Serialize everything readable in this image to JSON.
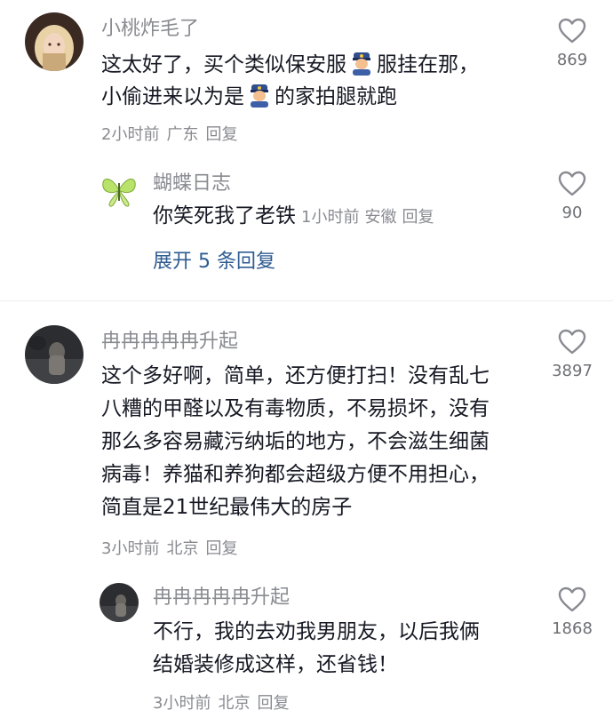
{
  "comments": [
    {
      "username": "小桃炸毛了",
      "line1_a": "这太好了，买个类似保安服",
      "line1_b": "服挂在那，",
      "line2_a": "小偷进来以为是",
      "line2_b": "的家拍腿就跑",
      "emoji": "police-officer-emoji",
      "time": "2小时前",
      "location": "广东",
      "reply_label": "回复",
      "like_count": "869",
      "reply": {
        "username": "蝴蝶日志",
        "text": "你笑死我了老铁",
        "time": "1小时前",
        "location": "安徽",
        "reply_label": "回复",
        "like_count": "90"
      },
      "expand_label": "展开 5 条回复"
    },
    {
      "username": "冉冉冉冉冉升起",
      "lines": [
        "这个多好啊，简单，还方便打扫！没有乱七",
        "八糟的甲醛以及有毒物质，不易损坏，没有",
        "那么多容易藏污纳垢的地方，不会滋生细菌",
        "病毒！养猫和养狗都会超级方便不用担心，",
        "简直是21世纪最伟大的房子"
      ],
      "time": "3小时前",
      "location": "北京",
      "reply_label": "回复",
      "like_count": "3897",
      "reply": {
        "username": "冉冉冉冉冉升起",
        "lines": [
          "不行，我的去劝我男朋友，以后我俩",
          "结婚装修成这样，还省钱！"
        ],
        "time": "3小时前",
        "location": "北京",
        "reply_label": "回复",
        "like_count": "1868"
      }
    }
  ],
  "icons": {
    "like": "heart-outline-icon"
  },
  "colors": {
    "link": "#2f5c92",
    "secondary": "#8a8b91",
    "text": "#161823"
  }
}
